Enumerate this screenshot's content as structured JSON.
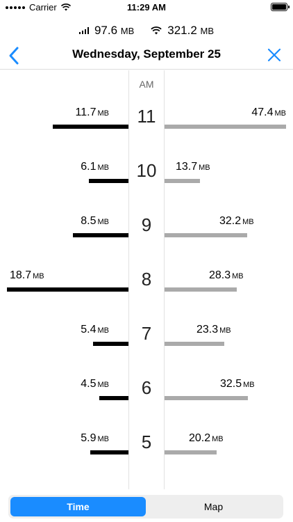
{
  "status_bar": {
    "carrier": "Carrier",
    "time": "11:29 AM"
  },
  "summary": {
    "cellular": {
      "value": "97.6",
      "unit": "MB",
      "icon": "cellular-signal-icon"
    },
    "wifi": {
      "value": "321.2",
      "unit": "MB",
      "icon": "wifi-icon"
    }
  },
  "nav": {
    "title": "Wednesday, September 25",
    "back_icon": "chevron-left-icon",
    "close_icon": "close-icon"
  },
  "chart_data": {
    "type": "bar",
    "period_label": "AM",
    "unit": "MB",
    "categories": [
      "11",
      "10",
      "9",
      "8",
      "7",
      "6",
      "5"
    ],
    "series": [
      {
        "values": [
          11.7,
          6.1,
          8.5,
          18.7,
          5.4,
          4.5,
          5.9
        ]
      },
      {
        "values": [
          47.4,
          13.7,
          32.2,
          28.3,
          23.3,
          32.5,
          20.2
        ]
      }
    ]
  },
  "tabs": [
    {
      "label": "Time",
      "active": true
    },
    {
      "label": "Map",
      "active": false
    }
  ],
  "colors": {
    "accent": "#1a8cff",
    "cellular_bar": "#000000",
    "wifi_bar": "#aaaaaa"
  }
}
